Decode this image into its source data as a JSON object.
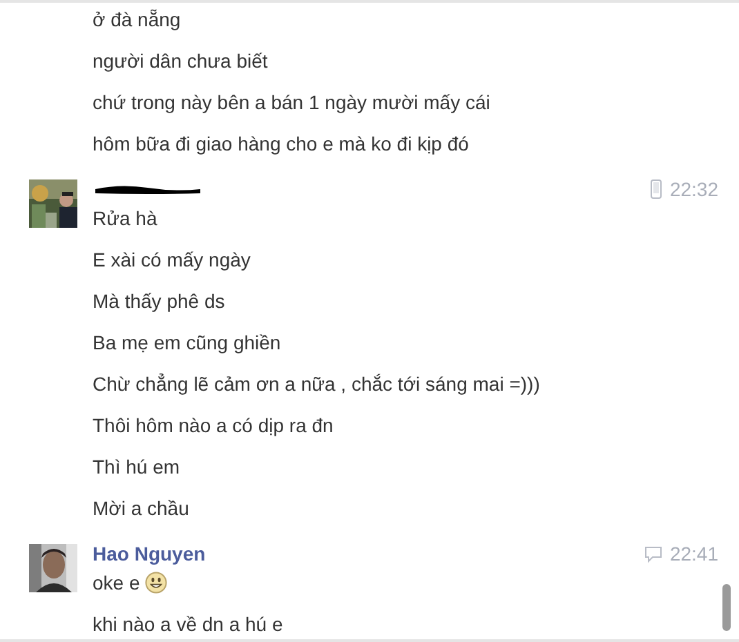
{
  "groups": [
    {
      "messages": [
        {
          "text": "ở đà nẵng"
        },
        {
          "text": "người dân chưa biết"
        },
        {
          "text": "chứ trong này bên a bán 1 ngày mười mấy cái"
        },
        {
          "text": "hôm bữa đi giao hàng cho e mà ko đi kịp đó"
        }
      ]
    },
    {
      "sender": {
        "kind": "redacted"
      },
      "time": "22:32",
      "source": {
        "kind": "mobile"
      },
      "messages": [
        {
          "text": "Rửa hà"
        },
        {
          "text": "E xài có mấy ngày"
        },
        {
          "text": "Mà thấy phê ds"
        },
        {
          "text": "Ba mẹ em cũng ghiền"
        },
        {
          "text": "Chừ chẳng lẽ cảm ơn a nữa , chắc tới sáng mai =)))"
        },
        {
          "text": "Thôi hôm nào a có dịp ra đn"
        },
        {
          "text": "Thì hú em"
        },
        {
          "text": "Mời a chầu"
        }
      ]
    },
    {
      "sender": {
        "kind": "name",
        "name": "Hao Nguyen"
      },
      "time": "22:41",
      "source": {
        "kind": "chat"
      },
      "messages": [
        {
          "text": "oke e",
          "emoji": true
        },
        {
          "text": "khi nào a về dn a hú e"
        }
      ]
    }
  ]
}
